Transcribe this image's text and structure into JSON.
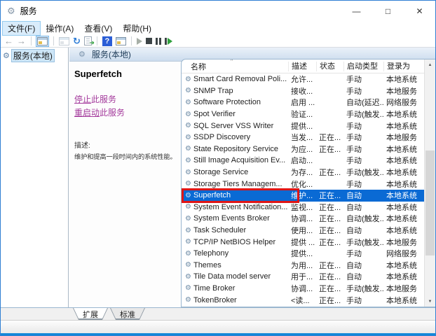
{
  "window": {
    "title": "服务",
    "controls": {
      "minimize": "—",
      "maximize": "□",
      "close": "✕"
    }
  },
  "icons": {
    "gear": "⚙",
    "back": "←",
    "forward": "→",
    "refresh": "↻",
    "help": "?",
    "scroll_up": "▲",
    "scroll_down": "▼"
  },
  "menu": {
    "items": [
      {
        "label": "文件(F)"
      },
      {
        "label": "操作(A)"
      },
      {
        "label": "查看(V)"
      },
      {
        "label": "帮助(H)"
      }
    ]
  },
  "tree": {
    "root": "服务(本地)"
  },
  "center_header": {
    "title": "服务(本地)"
  },
  "info": {
    "service_name": "Superfetch",
    "links": [
      {
        "hot": "停止",
        "rest": "此服务"
      },
      {
        "hot": "重启动",
        "rest": "此服务"
      }
    ],
    "desc_label": "描述:",
    "desc_text": "维护和提高一段时间内的系统性能。"
  },
  "table": {
    "sort_indicator": "^",
    "headers": [
      "名称",
      "描述",
      "状态",
      "启动类型",
      "登录为"
    ],
    "rows": [
      {
        "name": "Smart Card Removal Poli...",
        "desc": "允许...",
        "status": "",
        "startup": "手动",
        "logon": "本地系统",
        "selected": false
      },
      {
        "name": "SNMP Trap",
        "desc": "接收...",
        "status": "",
        "startup": "手动",
        "logon": "本地服务",
        "selected": false
      },
      {
        "name": "Software Protection",
        "desc": "启用 ...",
        "status": "",
        "startup": "自动(延迟...",
        "logon": "网络服务",
        "selected": false
      },
      {
        "name": "Spot Verifier",
        "desc": "验证...",
        "status": "",
        "startup": "手动(触发...",
        "logon": "本地系统",
        "selected": false
      },
      {
        "name": "SQL Server VSS Writer",
        "desc": "提供...",
        "status": "",
        "startup": "手动",
        "logon": "本地系统",
        "selected": false
      },
      {
        "name": "SSDP Discovery",
        "desc": "当发...",
        "status": "正在...",
        "startup": "手动",
        "logon": "本地服务",
        "selected": false
      },
      {
        "name": "State Repository Service",
        "desc": "为应...",
        "status": "正在...",
        "startup": "手动",
        "logon": "本地系统",
        "selected": false
      },
      {
        "name": "Still Image Acquisition Ev...",
        "desc": "启动...",
        "status": "",
        "startup": "手动",
        "logon": "本地系统",
        "selected": false
      },
      {
        "name": "Storage Service",
        "desc": "为存...",
        "status": "正在...",
        "startup": "手动(触发...",
        "logon": "本地系统",
        "selected": false
      },
      {
        "name": "Storage Tiers Managem...",
        "desc": "优化...",
        "status": "",
        "startup": "手动",
        "logon": "本地系统",
        "selected": false
      },
      {
        "name": "Superfetch",
        "desc": "维护...",
        "status": "正在...",
        "startup": "自动",
        "logon": "本地系统",
        "selected": true
      },
      {
        "name": "System Event Notification...",
        "desc": "监视...",
        "status": "正在...",
        "startup": "自动",
        "logon": "本地系统",
        "selected": false
      },
      {
        "name": "System Events Broker",
        "desc": "协调...",
        "status": "正在...",
        "startup": "自动(触发...",
        "logon": "本地系统",
        "selected": false
      },
      {
        "name": "Task Scheduler",
        "desc": "使用...",
        "status": "正在...",
        "startup": "自动",
        "logon": "本地系统",
        "selected": false
      },
      {
        "name": "TCP/IP NetBIOS Helper",
        "desc": "提供 ...",
        "status": "正在...",
        "startup": "手动(触发...",
        "logon": "本地服务",
        "selected": false
      },
      {
        "name": "Telephony",
        "desc": "提供...",
        "status": "",
        "startup": "手动",
        "logon": "网络服务",
        "selected": false
      },
      {
        "name": "Themes",
        "desc": "为用...",
        "status": "正在...",
        "startup": "自动",
        "logon": "本地系统",
        "selected": false
      },
      {
        "name": "Tile Data model server",
        "desc": "用于...",
        "status": "正在...",
        "startup": "自动",
        "logon": "本地系统",
        "selected": false
      },
      {
        "name": "Time Broker",
        "desc": "协调...",
        "status": "正在...",
        "startup": "手动(触发...",
        "logon": "本地服务",
        "selected": false
      },
      {
        "name": "TokenBroker",
        "desc": "<读...",
        "status": "正在...",
        "startup": "手动",
        "logon": "本地系统",
        "selected": false
      }
    ]
  },
  "tabs": {
    "extended": "扩展",
    "standard": "标准"
  },
  "colors": {
    "selection": "#0a6ad4",
    "annotation_box": "#e01515",
    "link": "#a43a9c",
    "window_border": "#2f7fd3"
  }
}
